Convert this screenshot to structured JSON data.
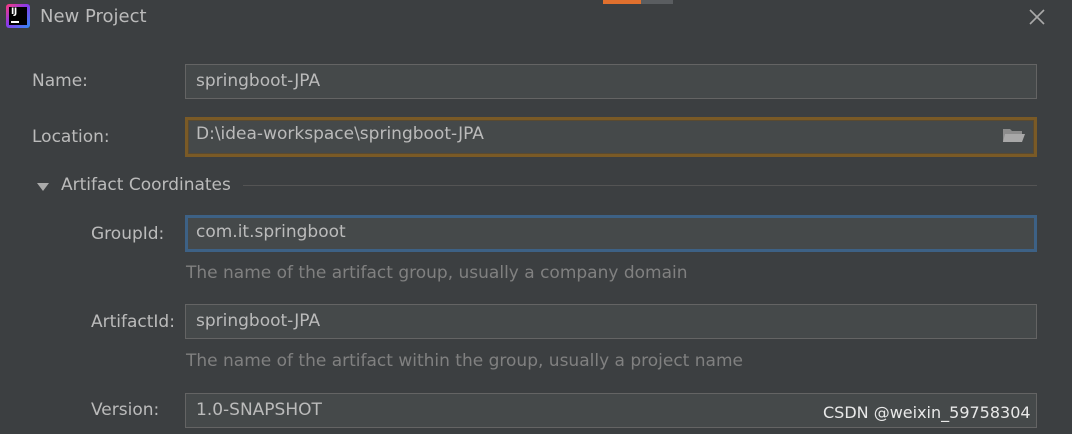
{
  "window": {
    "title": "New Project",
    "app_icon": "intellij-idea-icon",
    "app_icon_text": "IJ"
  },
  "form": {
    "name": {
      "label": "Name:",
      "value": "springboot-JPA"
    },
    "location": {
      "label": "Location:",
      "value": "D:\\idea-workspace\\springboot-JPA",
      "browse_icon": "folder-icon"
    },
    "artifact_section": {
      "title": "Artifact Coordinates",
      "expanded": true,
      "groupid": {
        "label": "GroupId:",
        "value": "com.it.springboot",
        "hint": "The name of the artifact group, usually a company domain"
      },
      "artifactid": {
        "label": "ArtifactId:",
        "value": "springboot-JPA",
        "hint": "The name of the artifact within the group, usually a project name"
      },
      "version": {
        "label": "Version:",
        "value": "1.0-SNAPSHOT"
      }
    }
  },
  "watermark": "CSDN @weixin_59758304",
  "colors": {
    "background": "#3c3f41",
    "field_bg": "#45494a",
    "focus_border": "#3d6185",
    "location_border": "#7a5a26",
    "text": "#bbbbbb",
    "hint": "#808080"
  }
}
